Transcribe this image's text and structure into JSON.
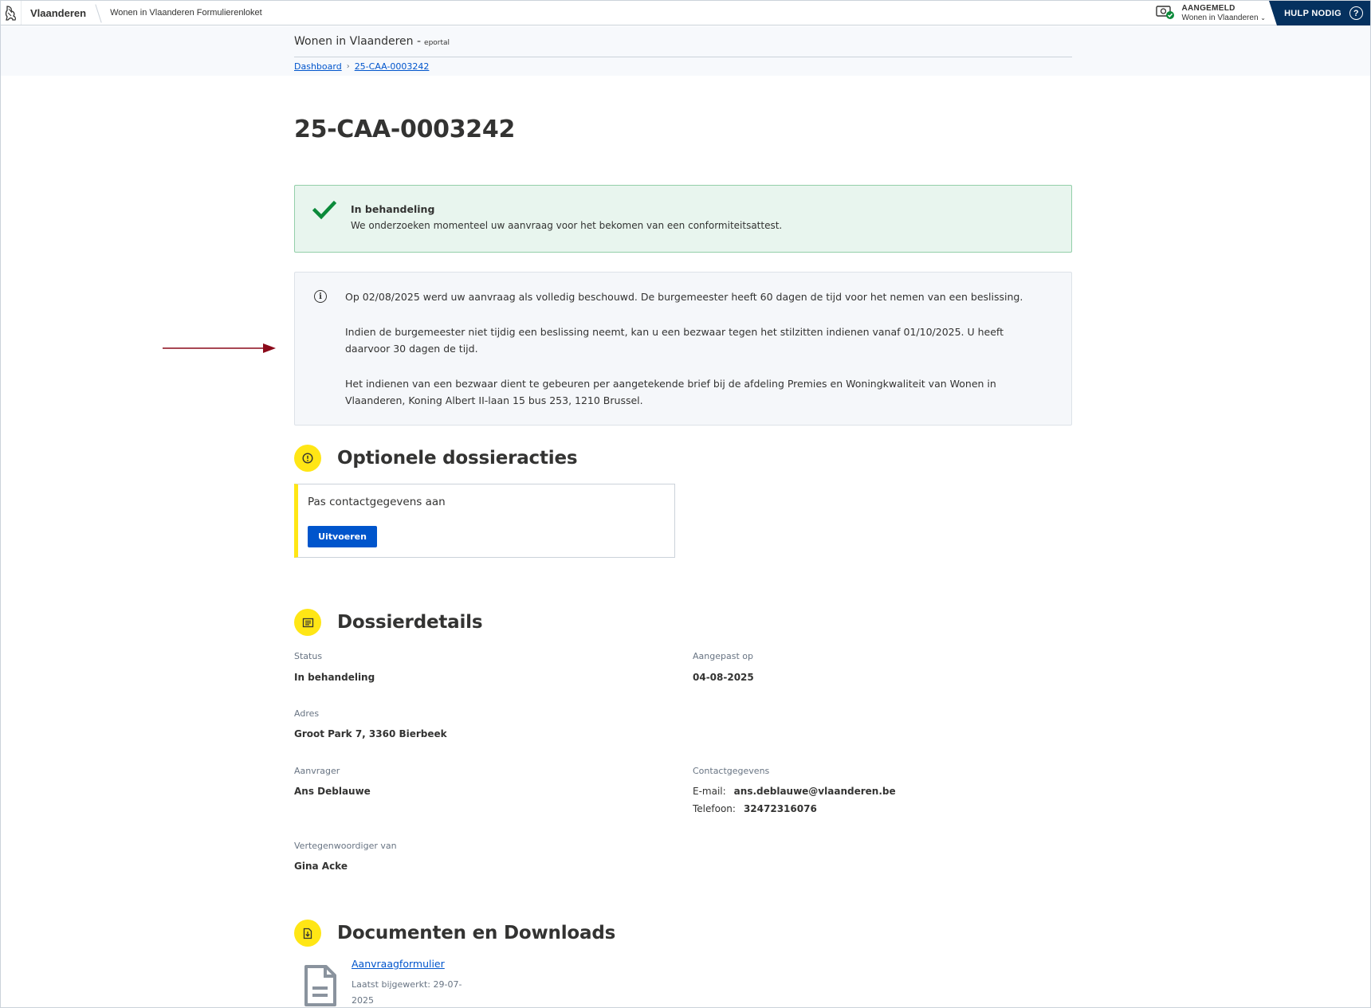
{
  "topbar": {
    "brand": "Vlaanderen",
    "portal_name": "Wonen in Vlaanderen Formulierenloket",
    "account_state": "AANGEMELD",
    "account_org": "Wonen in Vlaanderen",
    "help_label": "HULP NODIG",
    "help_glyph": "?"
  },
  "subheader": {
    "site_title": "Wonen in Vlaanderen -",
    "site_suffix": "eportal",
    "breadcrumbs": [
      "Dashboard",
      "25-CAA-0003242"
    ],
    "crumb_separator": "›"
  },
  "page": {
    "title": "25-CAA-0003242"
  },
  "status_alert": {
    "icon": "check-icon",
    "title": "In behandeling",
    "message": "We onderzoeken momenteel uw aanvraag voor het bekomen van een conformiteitsattest."
  },
  "info": {
    "icon": "info-icon",
    "glyph": "i",
    "paragraphs": [
      "Op 02/08/2025 werd uw aanvraag als volledig beschouwd. De burgemeester heeft 60 dagen de tijd voor het nemen van een beslissing.",
      "Indien de burgemeester niet tijdig een beslissing neemt, kan u een bezwaar tegen het stilzitten indienen vanaf 01/10/2025. U heeft daarvoor 30 dagen de tijd.",
      "Het indienen van een bezwaar dient te gebeuren per aangetekende brief bij de afdeling Premies en Woningkwaliteit van Wonen in Vlaanderen, Koning Albert II-laan 15 bus 253, 1210 Brussel."
    ]
  },
  "actions": {
    "title": "Optionele dossieracties",
    "icon": "alert-circle-icon",
    "card_title": "Pas contactgegevens aan",
    "button_label": "Uitvoeren"
  },
  "details": {
    "title": "Dossierdetails",
    "icon": "document-list-icon",
    "status_label": "Status",
    "status_value": "In behandeling",
    "modified_label": "Aangepast op",
    "modified_value": "04-08-2025",
    "address_label": "Adres",
    "address_value": "Groot Park 7, 3360 Bierbeek",
    "applicant_label": "Aanvrager",
    "applicant_value": "Ans Deblauwe",
    "contact_label": "Contactgegevens",
    "email_label": "E-mail:",
    "email_value": "ans.deblauwe@vlaanderen.be",
    "phone_label": "Telefoon:",
    "phone_value": "32472316076",
    "representative_label": "Vertegenwoordiger van",
    "representative_value": "Gina Acke"
  },
  "documents": {
    "title": "Documenten en Downloads",
    "icon": "download-icon",
    "items": [
      {
        "name": "Aanvraagformulier",
        "meta": "Laatst bijgewerkt: 29-07-2025",
        "icon": "file-icon"
      }
    ]
  },
  "colors": {
    "primary": "#0055cc",
    "header_dark": "#05315f",
    "success_bg": "#e8f5ee",
    "success_icon": "#0b8a3a",
    "section_yellow": "#ffe615",
    "annotation_arrow": "#8b0a1a"
  }
}
